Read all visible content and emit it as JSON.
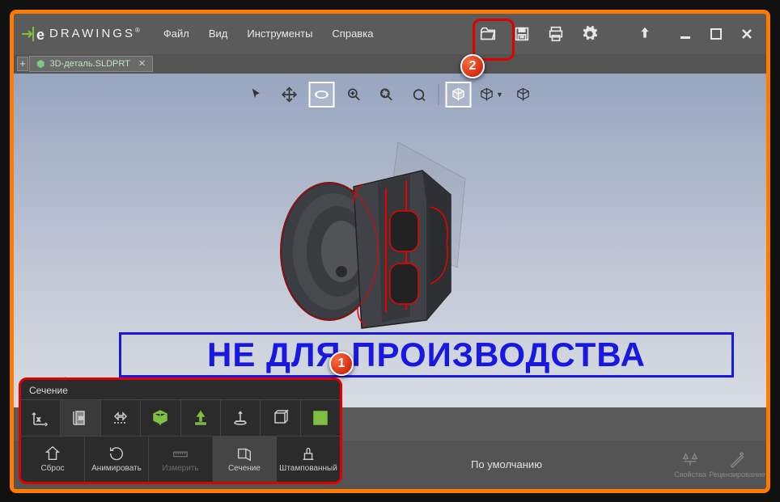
{
  "logo_text": "DRAWINGS",
  "menu": {
    "file": "Файл",
    "view": "Вид",
    "tools": "Инструменты",
    "help": "Справка"
  },
  "tab": {
    "name": "3D-деталь.SLDPRT"
  },
  "watermark": "НЕ ДЛЯ ПРОИЗВОДСТВА",
  "section_panel": {
    "title": "Сечение"
  },
  "bottom_tools": {
    "reset": "Сброс",
    "animate": "Анимировать",
    "measure": "Измерить",
    "section": "Сечение",
    "stamped": "Штампованный"
  },
  "status": {
    "default": "По умолчанию"
  },
  "right_tools": {
    "properties": "Свойства",
    "review": "Рецензирование"
  },
  "callouts": {
    "one": "1",
    "two": "2"
  }
}
